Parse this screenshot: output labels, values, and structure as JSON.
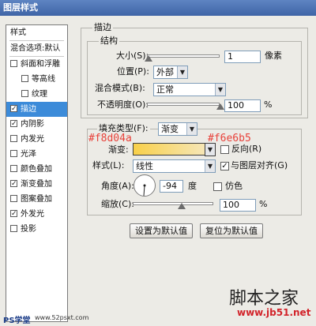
{
  "window": {
    "title": "图层样式"
  },
  "sidebar": {
    "header": "样式",
    "blend_options": "混合选项:默认",
    "items": [
      {
        "label": "斜面和浮雕",
        "checked": false,
        "indent": false,
        "selected": false
      },
      {
        "label": "等高线",
        "checked": false,
        "indent": true,
        "selected": false
      },
      {
        "label": "纹理",
        "checked": false,
        "indent": true,
        "selected": false
      },
      {
        "label": "描边",
        "checked": true,
        "indent": false,
        "selected": true
      },
      {
        "label": "内阴影",
        "checked": true,
        "indent": false,
        "selected": false
      },
      {
        "label": "内发光",
        "checked": false,
        "indent": false,
        "selected": false
      },
      {
        "label": "光泽",
        "checked": false,
        "indent": false,
        "selected": false
      },
      {
        "label": "颜色叠加",
        "checked": false,
        "indent": false,
        "selected": false
      },
      {
        "label": "渐变叠加",
        "checked": true,
        "indent": false,
        "selected": false
      },
      {
        "label": "图案叠加",
        "checked": false,
        "indent": false,
        "selected": false
      },
      {
        "label": "外发光",
        "checked": true,
        "indent": false,
        "selected": false
      },
      {
        "label": "投影",
        "checked": false,
        "indent": false,
        "selected": false
      }
    ]
  },
  "stroke": {
    "section_title": "描边",
    "structure": {
      "title": "结构",
      "size_label": "大小(S):",
      "size_value": "1",
      "size_unit": "像素",
      "position_label": "位置(P):",
      "position_value": "外部",
      "blend_label": "混合模式(B):",
      "blend_value": "正常",
      "opacity_label": "不透明度(O):",
      "opacity_value": "100",
      "opacity_unit": "%"
    },
    "fill": {
      "type_label": "填充类型(F):",
      "type_value": "渐变",
      "gradient_label": "渐变:",
      "reverse_label": "反向(R)",
      "reverse_checked": false,
      "style_label": "样式(L):",
      "style_value": "线性",
      "align_label": "与图层对齐(G)",
      "align_checked": true,
      "angle_label": "角度(A):",
      "angle_value": "-94",
      "angle_unit": "度",
      "dither_label": "仿色",
      "dither_checked": false,
      "scale_label": "缩放(C):",
      "scale_value": "100",
      "scale_unit": "%"
    },
    "buttons": {
      "set_default": "设置为默认值",
      "reset_default": "复位为默认值"
    }
  },
  "annotations": {
    "color1": "#f8d04a",
    "color2": "#f6e6b5"
  },
  "watermarks": {
    "left": "PS学堂",
    "left_url": "www.52psxt.com",
    "right_cn": "脚本之家",
    "right_url": "www.jb51.net"
  },
  "icons": {
    "check": "✓",
    "dropdown": "▼"
  },
  "colors": {
    "selected": "#3c8bd9",
    "gradient_start": "#f8d04a",
    "gradient_end": "#f6e6b5",
    "annotation": "#e8413a"
  }
}
